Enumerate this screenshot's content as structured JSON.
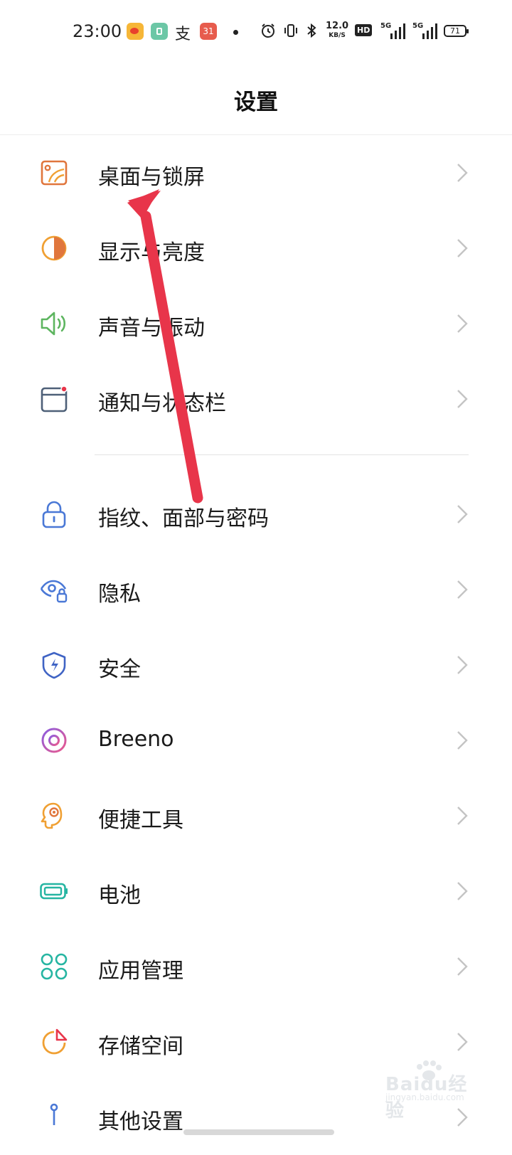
{
  "status_bar": {
    "time": "23:00",
    "calendar_badge": "31",
    "net_speed_value": "12.0",
    "net_speed_unit": "KB/S",
    "hd_label": "HD",
    "sim1_label": "5G",
    "sim2_label": "5G",
    "battery": "71",
    "icons": [
      "weibo-icon",
      "app-icon",
      "alipay-icon",
      "calendar-icon",
      "dot-icon",
      "alarm-icon",
      "vibrate-icon",
      "bluetooth-icon"
    ]
  },
  "header": {
    "title": "设置"
  },
  "settings": {
    "items": [
      {
        "label": "桌面与锁屏",
        "icon": "wallpaper-icon",
        "color": "#e0763d"
      },
      {
        "label": "显示与亮度",
        "icon": "brightness-icon",
        "color": "#f0a033"
      },
      {
        "label": "声音与振动",
        "icon": "speaker-icon",
        "color": "#5db55f"
      },
      {
        "label": "通知与状态栏",
        "icon": "notification-icon",
        "color": "#4e6078"
      },
      {
        "label": "指纹、面部与密码",
        "icon": "lock-icon",
        "color": "#4a78d6"
      },
      {
        "label": "隐私",
        "icon": "privacy-eye-icon",
        "color": "#4a78d6"
      },
      {
        "label": "安全",
        "icon": "shield-icon",
        "color": "#3f63c4"
      },
      {
        "label": "Breeno",
        "icon": "breeno-icon",
        "color": "#c45bd0"
      },
      {
        "label": "便捷工具",
        "icon": "tools-head-icon",
        "color": "#f0a033"
      },
      {
        "label": "电池",
        "icon": "battery-icon",
        "color": "#26b5a2"
      },
      {
        "label": "应用管理",
        "icon": "apps-grid-icon",
        "color": "#26b5a2"
      },
      {
        "label": "存储空间",
        "icon": "storage-pie-icon",
        "color": "#f0a033"
      },
      {
        "label": "其他设置",
        "icon": "other-settings-icon",
        "color": "#4a78d6"
      }
    ]
  },
  "annotation": {
    "arrow_color": "#e8354a"
  },
  "watermark": {
    "text": "Baidu经验",
    "url": "jingyan.baidu.com"
  }
}
